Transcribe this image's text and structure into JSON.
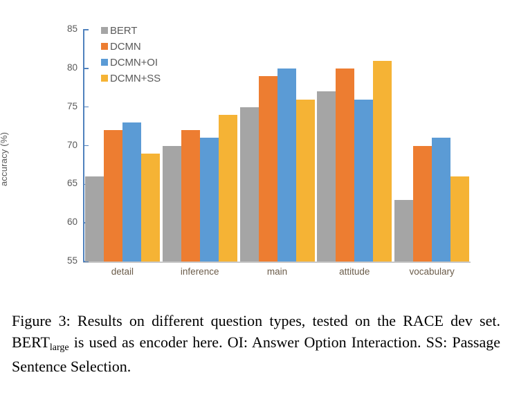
{
  "figure": {
    "caption_prefix": "Figure 3: Results on different question types, tested on the RACE dev set. BERT",
    "caption_subscript": "large",
    "caption_suffix": " is used as encoder here. OI: Answer Option Interaction. SS: Passage Sentence Selection."
  },
  "chart_data": {
    "type": "bar",
    "title": "",
    "xlabel": "",
    "ylabel": "accuracy (%)",
    "categories": [
      "detail",
      "inference",
      "main",
      "attitude",
      "vocabulary"
    ],
    "series": [
      {
        "name": "BERT",
        "color": "#a5a5a5",
        "values": [
          66,
          70,
          75,
          77,
          63
        ]
      },
      {
        "name": "DCMN",
        "color": "#ed7d31",
        "values": [
          72,
          72,
          79,
          80,
          70
        ]
      },
      {
        "name": "DCMN+OI",
        "color": "#5b9bd5",
        "values": [
          73,
          71,
          80,
          76,
          71
        ]
      },
      {
        "name": "DCMN+SS",
        "color": "#f5b335",
        "values": [
          69,
          74,
          76,
          81,
          66
        ]
      }
    ],
    "ylim": [
      55,
      85
    ],
    "yticks": [
      85,
      80,
      75,
      70,
      65,
      60,
      55
    ],
    "ytick_labels": [
      "85",
      "80",
      "75",
      "70",
      "65",
      "60",
      "55"
    ],
    "grid": false,
    "legend_position": "top-left",
    "axis_color": "#4f81bd",
    "baseline_color": "#c9c9c9"
  }
}
